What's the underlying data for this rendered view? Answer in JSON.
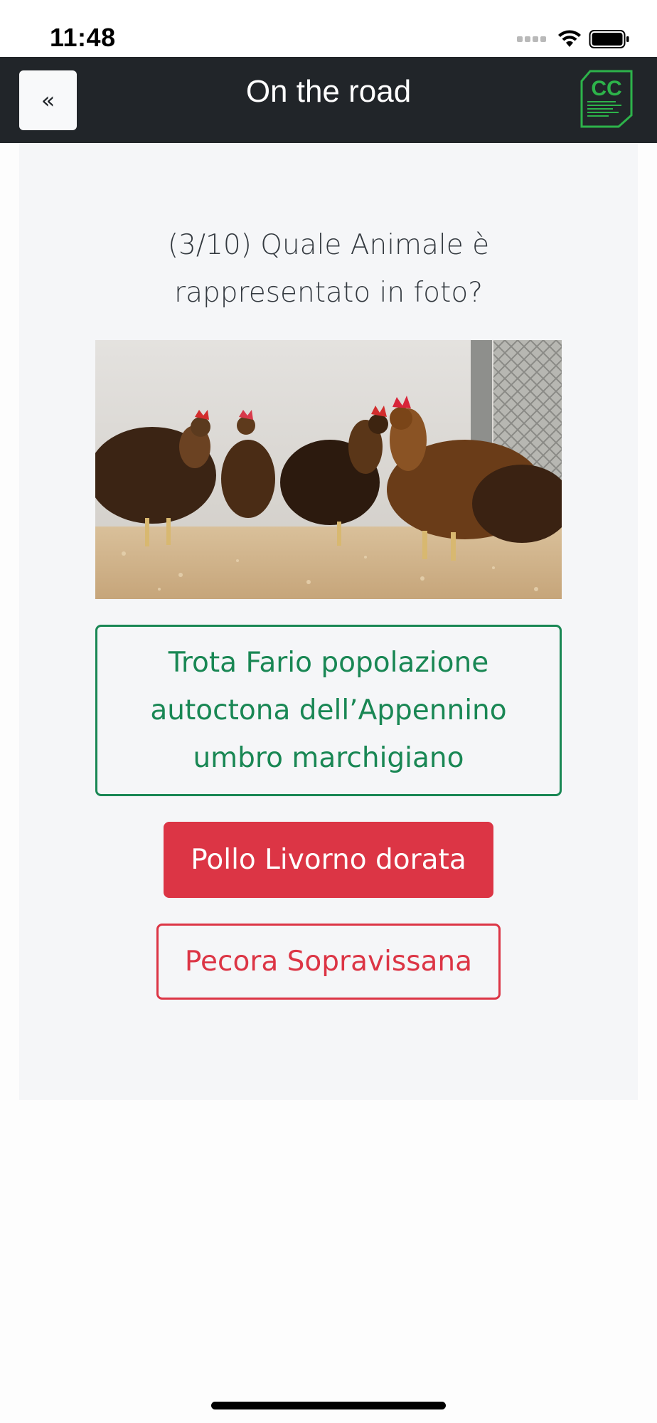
{
  "status_bar": {
    "time": "11:48",
    "icons": [
      "signal-icon",
      "wifi-icon",
      "battery-icon"
    ]
  },
  "header": {
    "back_label": "«",
    "title": "On the road",
    "logo_text": "CC",
    "logo_icon": "cc-logo-icon"
  },
  "quiz": {
    "question_line1": "(3/10) Quale Animale è",
    "question_line2": "rappresentato in foto?",
    "image_subject": "chicken-photo",
    "answers": [
      {
        "lines": [
          "Trota Fario popolazione",
          "autoctona dell’Appennino",
          "umbro marchigiano"
        ],
        "state": "correct-outline",
        "color": "#198754"
      },
      {
        "label": "Pollo Livorno dorata",
        "state": "selected-wrong",
        "color": "#dc3545"
      },
      {
        "label": "Pecora Sopravissana",
        "state": "wrong-outline",
        "color": "#dc3545"
      }
    ]
  },
  "colors": {
    "navbar": "#212529",
    "card_bg": "#f5f6f8",
    "green": "#198754",
    "red": "#dc3545",
    "logo_green": "#2db34a"
  }
}
